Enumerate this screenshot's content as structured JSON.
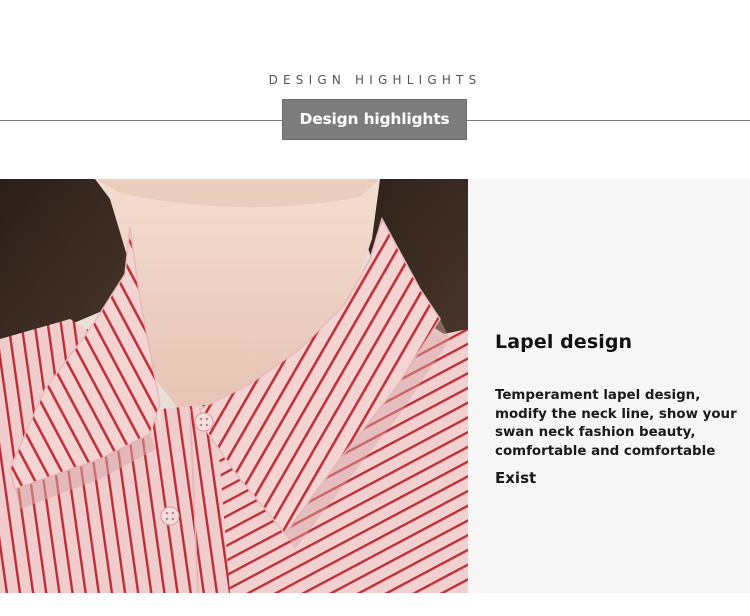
{
  "section": {
    "subtitle": "DESIGN HIGHLIGHTS",
    "title": "Design highlights"
  },
  "photo": {
    "subject": "pink-red-striped-lapel-shirt-collar"
  },
  "feature": {
    "title": "Lapel design",
    "description": "Temperament lapel design, modify the neck line, show your swan neck fashion beauty, comfortable and comfortable",
    "extra": "Exist"
  },
  "colors": {
    "title_box_bg": "#7d7d7d",
    "stripe_red": "#c0323a",
    "shirt_pink": "#f2cfcf",
    "panel_bg": "#f6f6f6"
  }
}
